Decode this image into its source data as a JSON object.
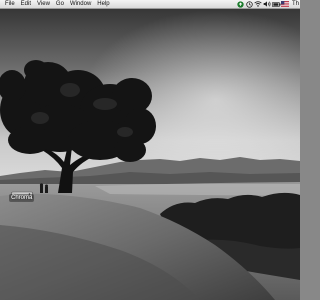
{
  "menubar": {
    "app_menu": "",
    "items": [
      "File",
      "Edit",
      "View",
      "Go",
      "Window",
      "Help"
    ],
    "status_icons": [
      "sync-icon",
      "time-machine-icon",
      "wifi-icon",
      "volume-icon",
      "battery-icon",
      "keyboard-flag-icon"
    ],
    "clock": "Th"
  },
  "desktop": {
    "icons": [
      {
        "label": "Chroma",
        "icon": "drive-icon"
      }
    ]
  },
  "colors": {
    "menubar_bg": "#e8e8e8",
    "menubar_text": "#111111",
    "label_text": "#ffffff"
  }
}
